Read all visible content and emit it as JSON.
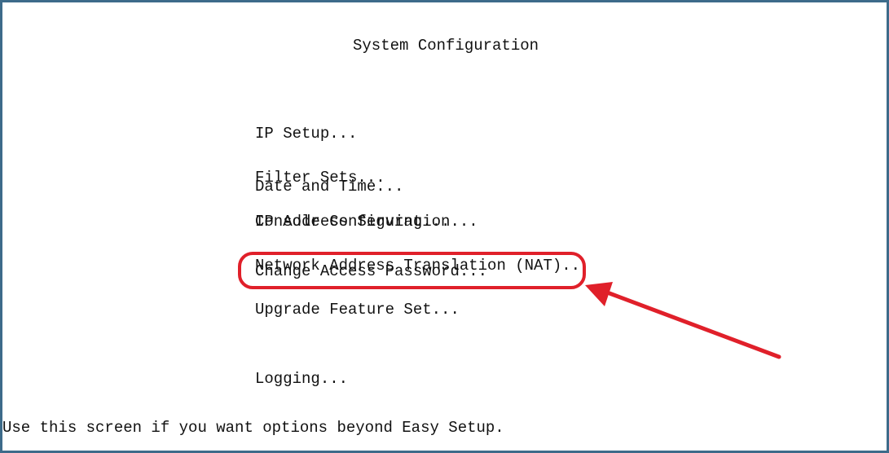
{
  "screen": {
    "title": "System Configuration",
    "menu": {
      "group1": [
        "IP Setup...",
        "Filter Sets...",
        "IP Address Serving...",
        "Network Address Translation (NAT)..."
      ],
      "date_time": "Date and Time...",
      "console_configuration": "Console Configuration...",
      "change_access_password": "Change Access Password...",
      "upgrade_feature_set": "Upgrade Feature Set...",
      "logging": "Logging..."
    },
    "status_line": "Use this screen if you want options beyond Easy Setup."
  },
  "annotation": {
    "highlight_color": "#e0202a",
    "frame_color": "#3d6b8a",
    "arrow_icon": "red-arrow-icon"
  }
}
